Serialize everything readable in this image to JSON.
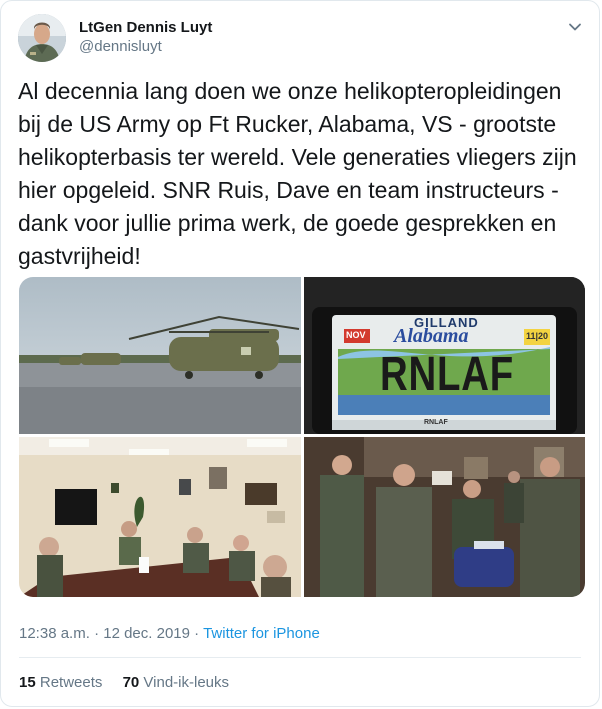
{
  "author": {
    "display_name": "LtGen Dennis Luyt",
    "handle": "@dennisluyt"
  },
  "tweet": {
    "text": "Al decennia lang doen we onze helikopteropleidingen bij de US Army op Ft Rucker, Alabama, VS - grootste helikopterbasis ter wereld. Vele generaties vliegers zijn hier opgeleid. SNR Ruis, Dave en team instructeurs - dank voor jullie prima werk, de goede gesprekken en gastvrijheid!"
  },
  "media": {
    "plate": {
      "top_text": "GILLAND",
      "state": "Alabama",
      "country_sticker": "NOV",
      "year_sticker_month": "11",
      "year_sticker_year": "20",
      "plate_number": "RNLAF",
      "frame_bottom": "RNLAF"
    }
  },
  "meta": {
    "time": "12:38 a.m.",
    "separator": "·",
    "date": "12 dec. 2019",
    "separator2": "·",
    "source": "Twitter for iPhone"
  },
  "stats": {
    "retweets_count": "15",
    "retweets_label": "Retweets",
    "likes_count": "70",
    "likes_label": "Vind-ik-leuks"
  }
}
